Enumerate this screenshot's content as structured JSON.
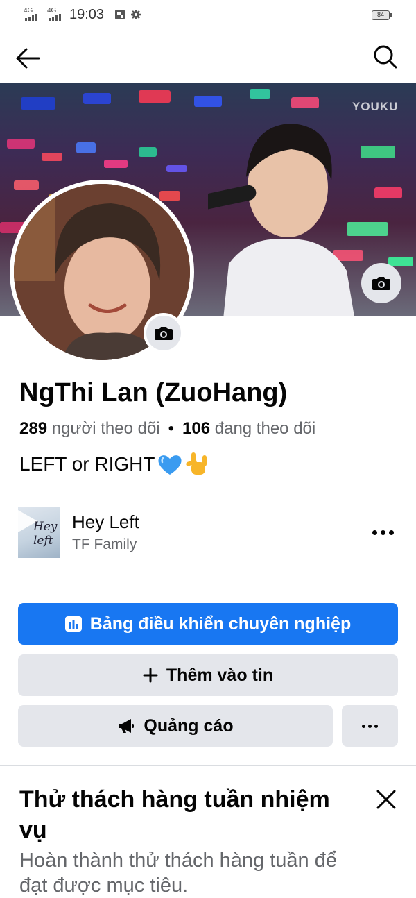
{
  "status_bar": {
    "network_1": "4G",
    "network_2": "4G",
    "time": "19:03",
    "battery": "84"
  },
  "nav": {
    "back_icon": "arrow-left-icon",
    "search_icon": "search-icon"
  },
  "cover": {
    "watermark": "YOUKU",
    "camera_icon": "camera-icon"
  },
  "profile": {
    "name": "NgThi Lan (ZuoHang)",
    "followers_count": "289",
    "followers_label": "người theo dõi",
    "separator": "•",
    "following_count": "106",
    "following_label": "đang theo dõi",
    "bio": "LEFT or RIGHT",
    "bio_emojis": [
      "blue-heart-icon",
      "love-you-gesture-icon"
    ]
  },
  "music": {
    "title": "Hey Left",
    "artist": "TF Family",
    "thumb_text": "Hey left"
  },
  "actions": {
    "dashboard_label": "Bảng điều khiển chuyên nghiệp",
    "add_story_label": "Thêm vào tin",
    "ads_label": "Quảng cáo"
  },
  "challenge": {
    "title": "Thử thách hàng tuần nhiệm vụ",
    "description": "Hoàn thành thử thách hàng tuần để đạt được mục tiêu."
  },
  "colors": {
    "primary": "#1877f2",
    "secondary_bg": "#e4e6eb",
    "muted_text": "#65676b"
  }
}
